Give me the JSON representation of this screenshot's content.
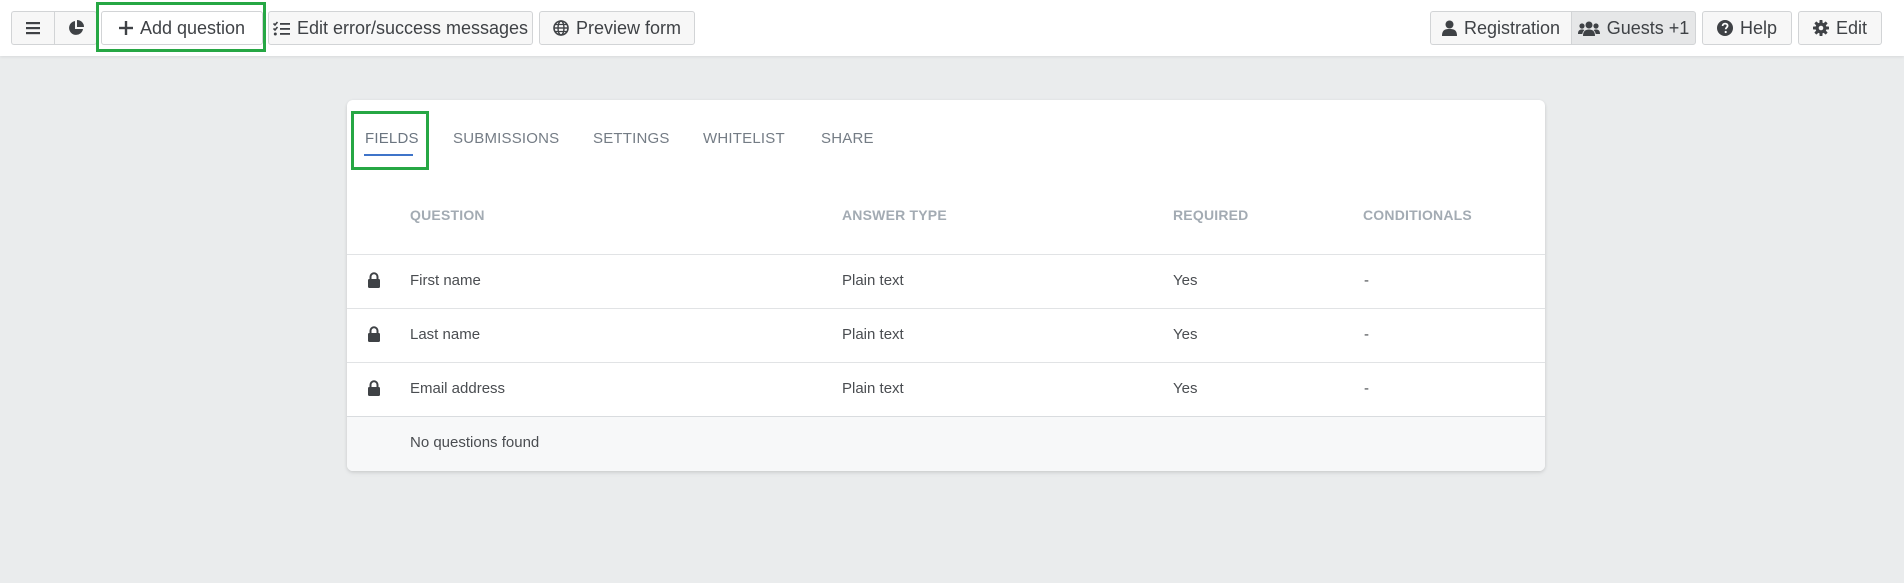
{
  "toolbar": {
    "add_question": "Add question",
    "edit_messages": "Edit error/success messages",
    "preview_form": "Preview form",
    "registration": "Registration",
    "guests": "Guests +1",
    "help": "Help",
    "edit": "Edit"
  },
  "tabs": [
    "FIELDS",
    "SUBMISSIONS",
    "SETTINGS",
    "WHITELIST",
    "SHARE"
  ],
  "table": {
    "headers": [
      "QUESTION",
      "ANSWER TYPE",
      "REQUIRED",
      "CONDITIONALS"
    ],
    "rows": [
      {
        "question": "First name",
        "answer_type": "Plain text",
        "required": "Yes",
        "conditionals": "-"
      },
      {
        "question": "Last name",
        "answer_type": "Plain text",
        "required": "Yes",
        "conditionals": "-"
      },
      {
        "question": "Email address",
        "answer_type": "Plain text",
        "required": "Yes",
        "conditionals": "-"
      }
    ],
    "empty_message": "No questions found"
  },
  "colors": {
    "highlight": "#26a744",
    "tab_underline": "#3f74c9"
  },
  "icons": [
    "menu-icon",
    "pie-chart-icon",
    "plus-icon",
    "list-check-icon",
    "globe-icon",
    "user-icon",
    "users-icon",
    "question-circle-icon",
    "gear-icon",
    "lock-icon"
  ]
}
